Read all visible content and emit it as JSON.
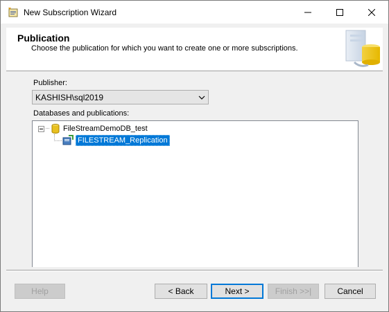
{
  "window": {
    "title": "New Subscription Wizard",
    "icon": "wizard-icon"
  },
  "header": {
    "title": "Publication",
    "subtitle": "Choose the publication for which you want to create one or more subscriptions."
  },
  "publisher": {
    "label": "Publisher:",
    "value": "KASHISH\\sql2019"
  },
  "tree": {
    "label": "Databases and publications:",
    "database": "FileStreamDemoDB_test",
    "publication": "FILESTREAM_Replication"
  },
  "buttons": {
    "help": "Help",
    "back": "< Back",
    "next": "Next >",
    "finish": "Finish >>|",
    "cancel": "Cancel"
  },
  "colors": {
    "selection": "#0078d7",
    "dialog_bg": "#f0f0f0"
  }
}
